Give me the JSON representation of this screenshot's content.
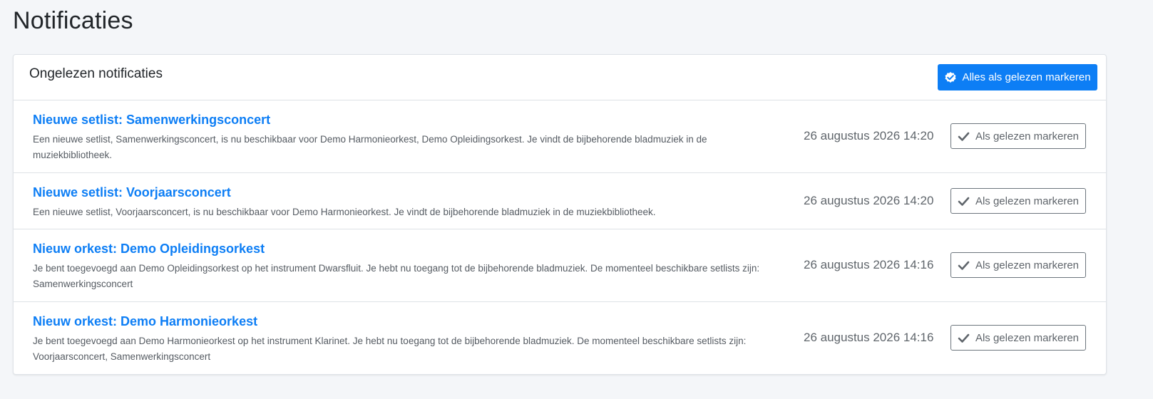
{
  "page": {
    "title": "Notificaties"
  },
  "card": {
    "title": "Ongelezen notificaties",
    "mark_all_label": "Alles als gelezen markeren",
    "mark_all_icon": "double-check-icon"
  },
  "notifications": [
    {
      "title": "Nieuwe setlist: Samenwerkingsconcert",
      "description": "Een nieuwe setlist, Samenwerkingsconcert, is nu beschikbaar voor Demo Harmonieorkest, Demo Opleidingsorkest. Je vindt de bijbehorende bladmuziek in de muziekbibliotheek.",
      "timestamp": "26 augustus 2026 14:20",
      "action_label": "Als gelezen markeren"
    },
    {
      "title": "Nieuwe setlist: Voorjaarsconcert",
      "description": "Een nieuwe setlist, Voorjaarsconcert, is nu beschikbaar voor Demo Harmonieorkest. Je vindt de bijbehorende bladmuziek in de muziekbibliotheek.",
      "timestamp": "26 augustus 2026 14:20",
      "action_label": "Als gelezen markeren"
    },
    {
      "title": "Nieuw orkest: Demo Opleidingsorkest",
      "description": "Je bent toegevoegd aan Demo Opleidingsorkest op het instrument Dwarsfluit. Je hebt nu toegang tot de bijbehorende bladmuziek. De momenteel beschikbare setlists zijn: Samenwerkingsconcert",
      "timestamp": "26 augustus 2026 14:16",
      "action_label": "Als gelezen markeren"
    },
    {
      "title": "Nieuw orkest: Demo Harmonieorkest",
      "description": "Je bent toegevoegd aan Demo Harmonieorkest op het instrument Klarinet. Je hebt nu toegang tot de bijbehorende bladmuziek. De momenteel beschikbare setlists zijn: Voorjaarsconcert, Samenwerkingsconcert",
      "timestamp": "26 augustus 2026 14:16",
      "action_label": "Als gelezen markeren"
    }
  ],
  "colors": {
    "accent": "#0d7ef5",
    "background": "#f4f6f9",
    "muted_text": "#5f656b"
  }
}
